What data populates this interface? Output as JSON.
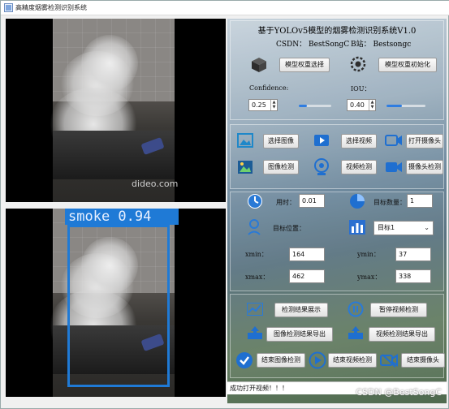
{
  "window": {
    "title": "高精度烟雾检测识别系统"
  },
  "header": {
    "title": "基于YOLOv5模型的烟雾检测识别系统V1.0",
    "csdn": "CSDN：  BestSongC",
    "bilibili": "B站：  Bestsongc"
  },
  "model": {
    "select_button": "模型权重选择",
    "init_button": "模型权重初始化",
    "confidence_label": "Confidence:",
    "confidence_value": "0.25",
    "confidence_level": 0.25,
    "iou_label": "IOU：",
    "iou_value": "0.40",
    "iou_level": 0.4
  },
  "media": {
    "select_image": "选择图像",
    "select_video": "选择视频",
    "open_camera": "打开摄像头",
    "image_detect": "图像检测",
    "video_detect": "视频检测",
    "camera_detect": "摄像头检测"
  },
  "results": {
    "time_label": "用时：",
    "time_value": "0.01",
    "count_label": "目标数量：",
    "count_value": "1",
    "position_label": "目标位置：",
    "target_select": "目标1",
    "xmin_label": "xmin：",
    "xmin_value": "164",
    "ymin_label": "ymin：",
    "ymin_value": "37",
    "xmax_label": "xmax：",
    "xmax_value": "462",
    "ymax_label": "ymax：",
    "ymax_value": "338"
  },
  "actions": {
    "show_results": "检测结果展示",
    "pause_video": "暂停视频检测",
    "export_image": "图像检测结果导出",
    "export_video": "视频检测结果导出",
    "end_image": "结束图像检测",
    "end_video": "结束视频检测",
    "end_camera": "结束摄像头"
  },
  "detection": {
    "label": "smoke 0.94"
  },
  "video": {
    "watermark": "dideo.com"
  },
  "status": {
    "message": "成功打开视频！！！"
  },
  "footer": {
    "credit": "CSDN @BestSongC"
  },
  "colors": {
    "detection_box": "#1f7ad6",
    "accent": "#2f7de1"
  }
}
